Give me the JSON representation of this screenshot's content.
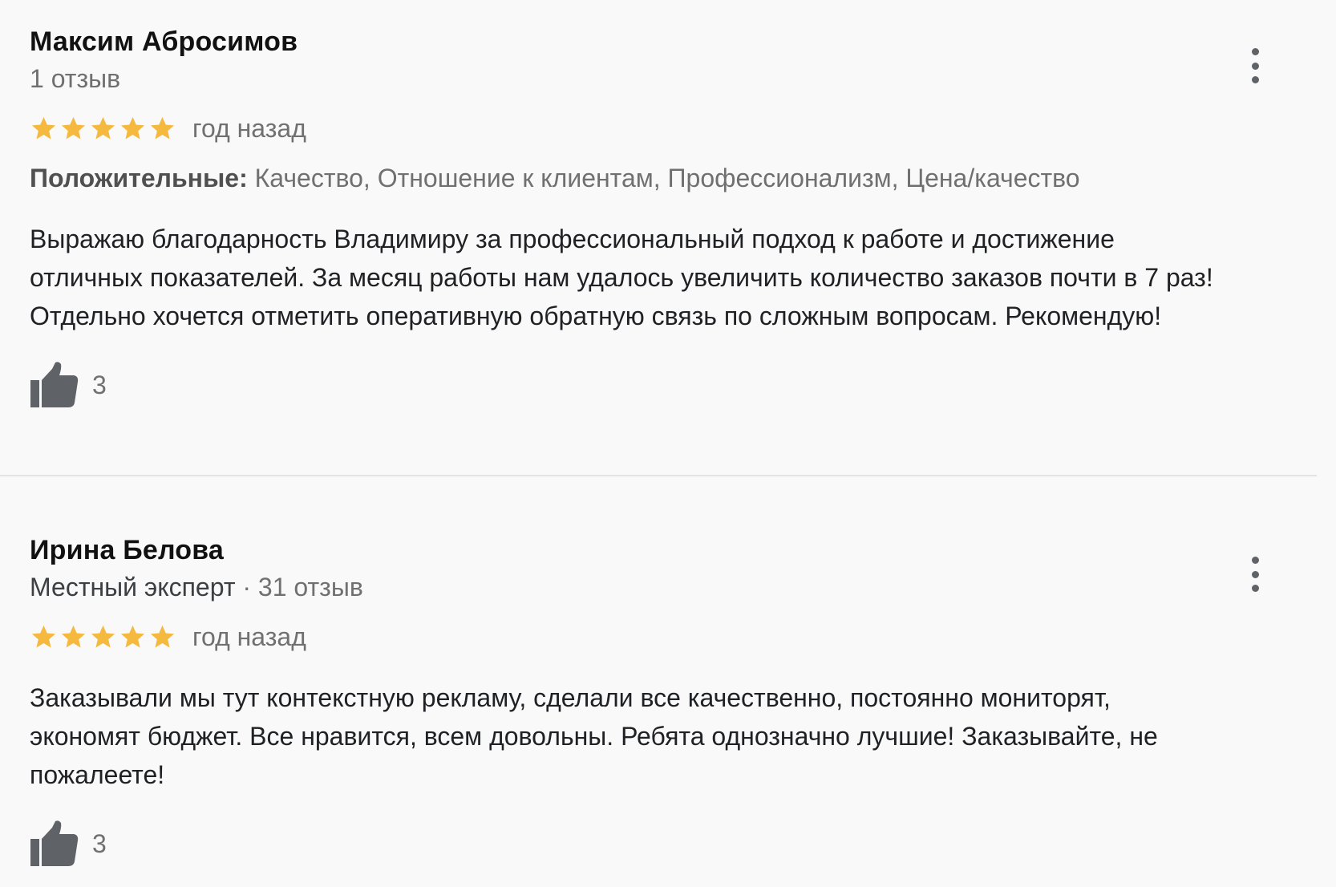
{
  "reviews": [
    {
      "author": "Максим Абросимов",
      "badge": "",
      "review_count": "1 отзыв",
      "rating": 5,
      "rating_max": 5,
      "when": "год назад",
      "tags_label": "Положительные:",
      "tags": "Качество, Отношение к клиентам, Профессионализм, Цена/качество",
      "text_lines": [
        "Выражаю благодарность Владимиру за профессиональный подход к работе и достижение",
        "отличных показателей. За месяц работы нам удалось увеличить количество заказов почти в 7 раз!",
        "Отдельно хочется отметить оперативную обратную связь по сложным вопросам. Рекомендую!"
      ],
      "likes": "3"
    },
    {
      "author": "Ирина Белова",
      "badge": "Местный эксперт",
      "separator": "·",
      "review_count": "31 отзыв",
      "rating": 5,
      "rating_max": 5,
      "when": "год назад",
      "text_lines": [
        "Заказывали мы тут контекстную рекламу, сделали все качественно, постоянно мониторят,",
        "экономят бюджет. Все нравится, всем довольны. Ребята однозначно  лучшие! Заказывайте, не",
        "пожалеете!"
      ],
      "likes": "3"
    }
  ],
  "colors": {
    "star": "#f4b93e",
    "thumb": "#5f6368",
    "muted_text": "#707070",
    "background": "#f9f9f9"
  },
  "icons": {
    "star": "star-icon",
    "like": "thumbs-up-icon",
    "menu": "more-vert-icon"
  }
}
